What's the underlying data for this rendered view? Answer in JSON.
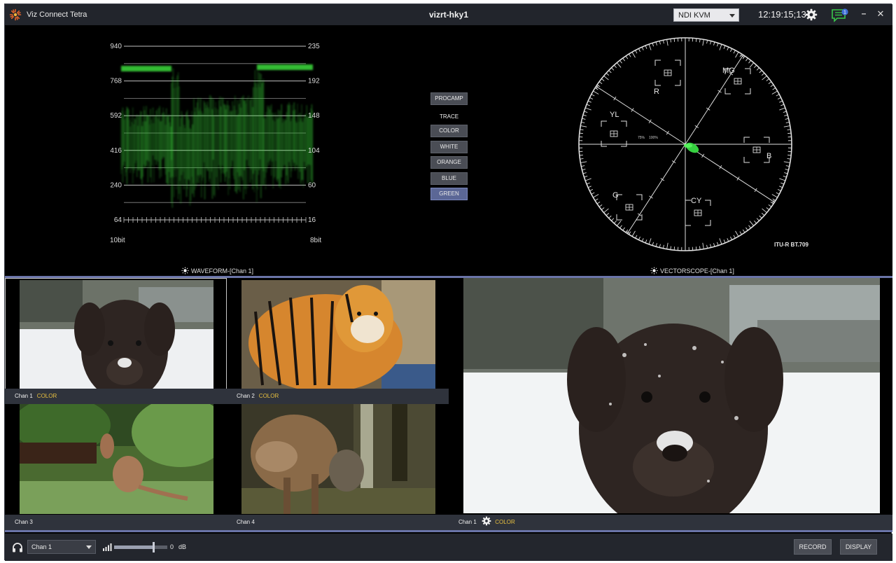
{
  "titlebar": {
    "app_name": "Viz Connect Tetra",
    "host_name": "vizrt-hky1",
    "source_select": "NDI KVM",
    "timecode": "12:19:15;13",
    "message_count": "1",
    "minimize": "–",
    "close": "✕"
  },
  "waveform": {
    "left_ticks": [
      "940",
      "768",
      "592",
      "416",
      "240",
      "64"
    ],
    "right_ticks": [
      "235",
      "192",
      "148",
      "104",
      "60",
      "16"
    ],
    "left_unit": "10bit",
    "right_unit": "8bit",
    "trace_color": "#3cdc3c",
    "label": "WAVEFORM-[Chan 1]"
  },
  "controls": {
    "procamp": "PROCAMP",
    "trace_label": "TRACE",
    "traces": [
      "COLOR",
      "WHITE",
      "ORANGE",
      "BLUE",
      "GREEN"
    ],
    "active_trace": "GREEN"
  },
  "vectorscope": {
    "targets": [
      "R",
      "MG",
      "B",
      "CY",
      "G",
      "YL"
    ],
    "scale_marks": [
      "75%",
      "100%"
    ],
    "standard": "ITU-R BT.709",
    "label": "VECTORSCOPE-[Chan 1]"
  },
  "channels": [
    {
      "name": "Chan 1",
      "tag": "COLOR"
    },
    {
      "name": "Chan 2",
      "tag": "COLOR"
    },
    {
      "name": "Chan 3",
      "tag": ""
    },
    {
      "name": "Chan 4",
      "tag": ""
    }
  ],
  "program": {
    "name": "Chan 1",
    "tag": "COLOR"
  },
  "audio": {
    "channel": "Chan 1",
    "volume": "0",
    "unit": "dB",
    "level": 0.72
  },
  "buttons": {
    "record": "RECORD",
    "display": "DISPLAY"
  },
  "colors": {
    "accent": "#6a74a8",
    "tag": "#e8c040",
    "active_button": "#5b6796"
  }
}
